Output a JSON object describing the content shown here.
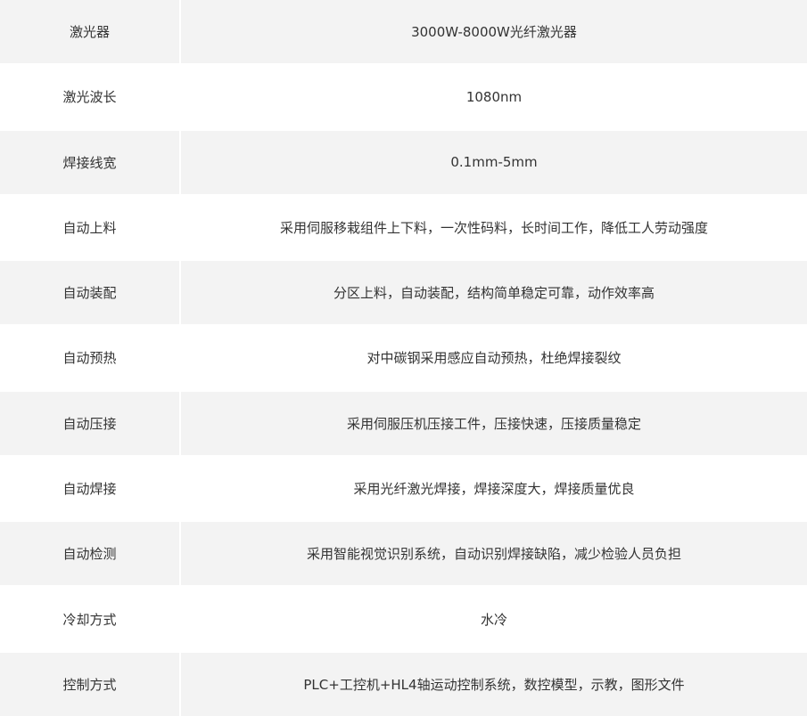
{
  "spec_table": {
    "rows": [
      {
        "label": "激光器",
        "value": "3000W-8000W光纤激光器"
      },
      {
        "label": "激光波长",
        "value": "1080nm"
      },
      {
        "label": "焊接线宽",
        "value": "0.1mm-5mm"
      },
      {
        "label": "自动上料",
        "value": "采用伺服移栽组件上下料，一次性码料，长时间工作，降低工人劳动强度"
      },
      {
        "label": "自动装配",
        "value": "分区上料，自动装配，结构简单稳定可靠，动作效率高"
      },
      {
        "label": "自动预热",
        "value": "对中碳钢采用感应自动预热，杜绝焊接裂纹"
      },
      {
        "label": "自动压接",
        "value": "采用伺服压机压接工件，压接快速，压接质量稳定"
      },
      {
        "label": "自动焊接",
        "value": "采用光纤激光焊接，焊接深度大，焊接质量优良"
      },
      {
        "label": "自动检测",
        "value": "采用智能视觉识别系统，自动识别焊接缺陷，减少检验人员负担"
      },
      {
        "label": "冷却方式",
        "value": "水冷"
      },
      {
        "label": "控制方式",
        "value": "PLC+工控机+HL4轴运动控制系统，数控模型，示教，图形文件"
      }
    ]
  },
  "colors": {
    "row_shaded": "#f3f3f3",
    "row_plain": "#ffffff",
    "text": "#333333"
  }
}
